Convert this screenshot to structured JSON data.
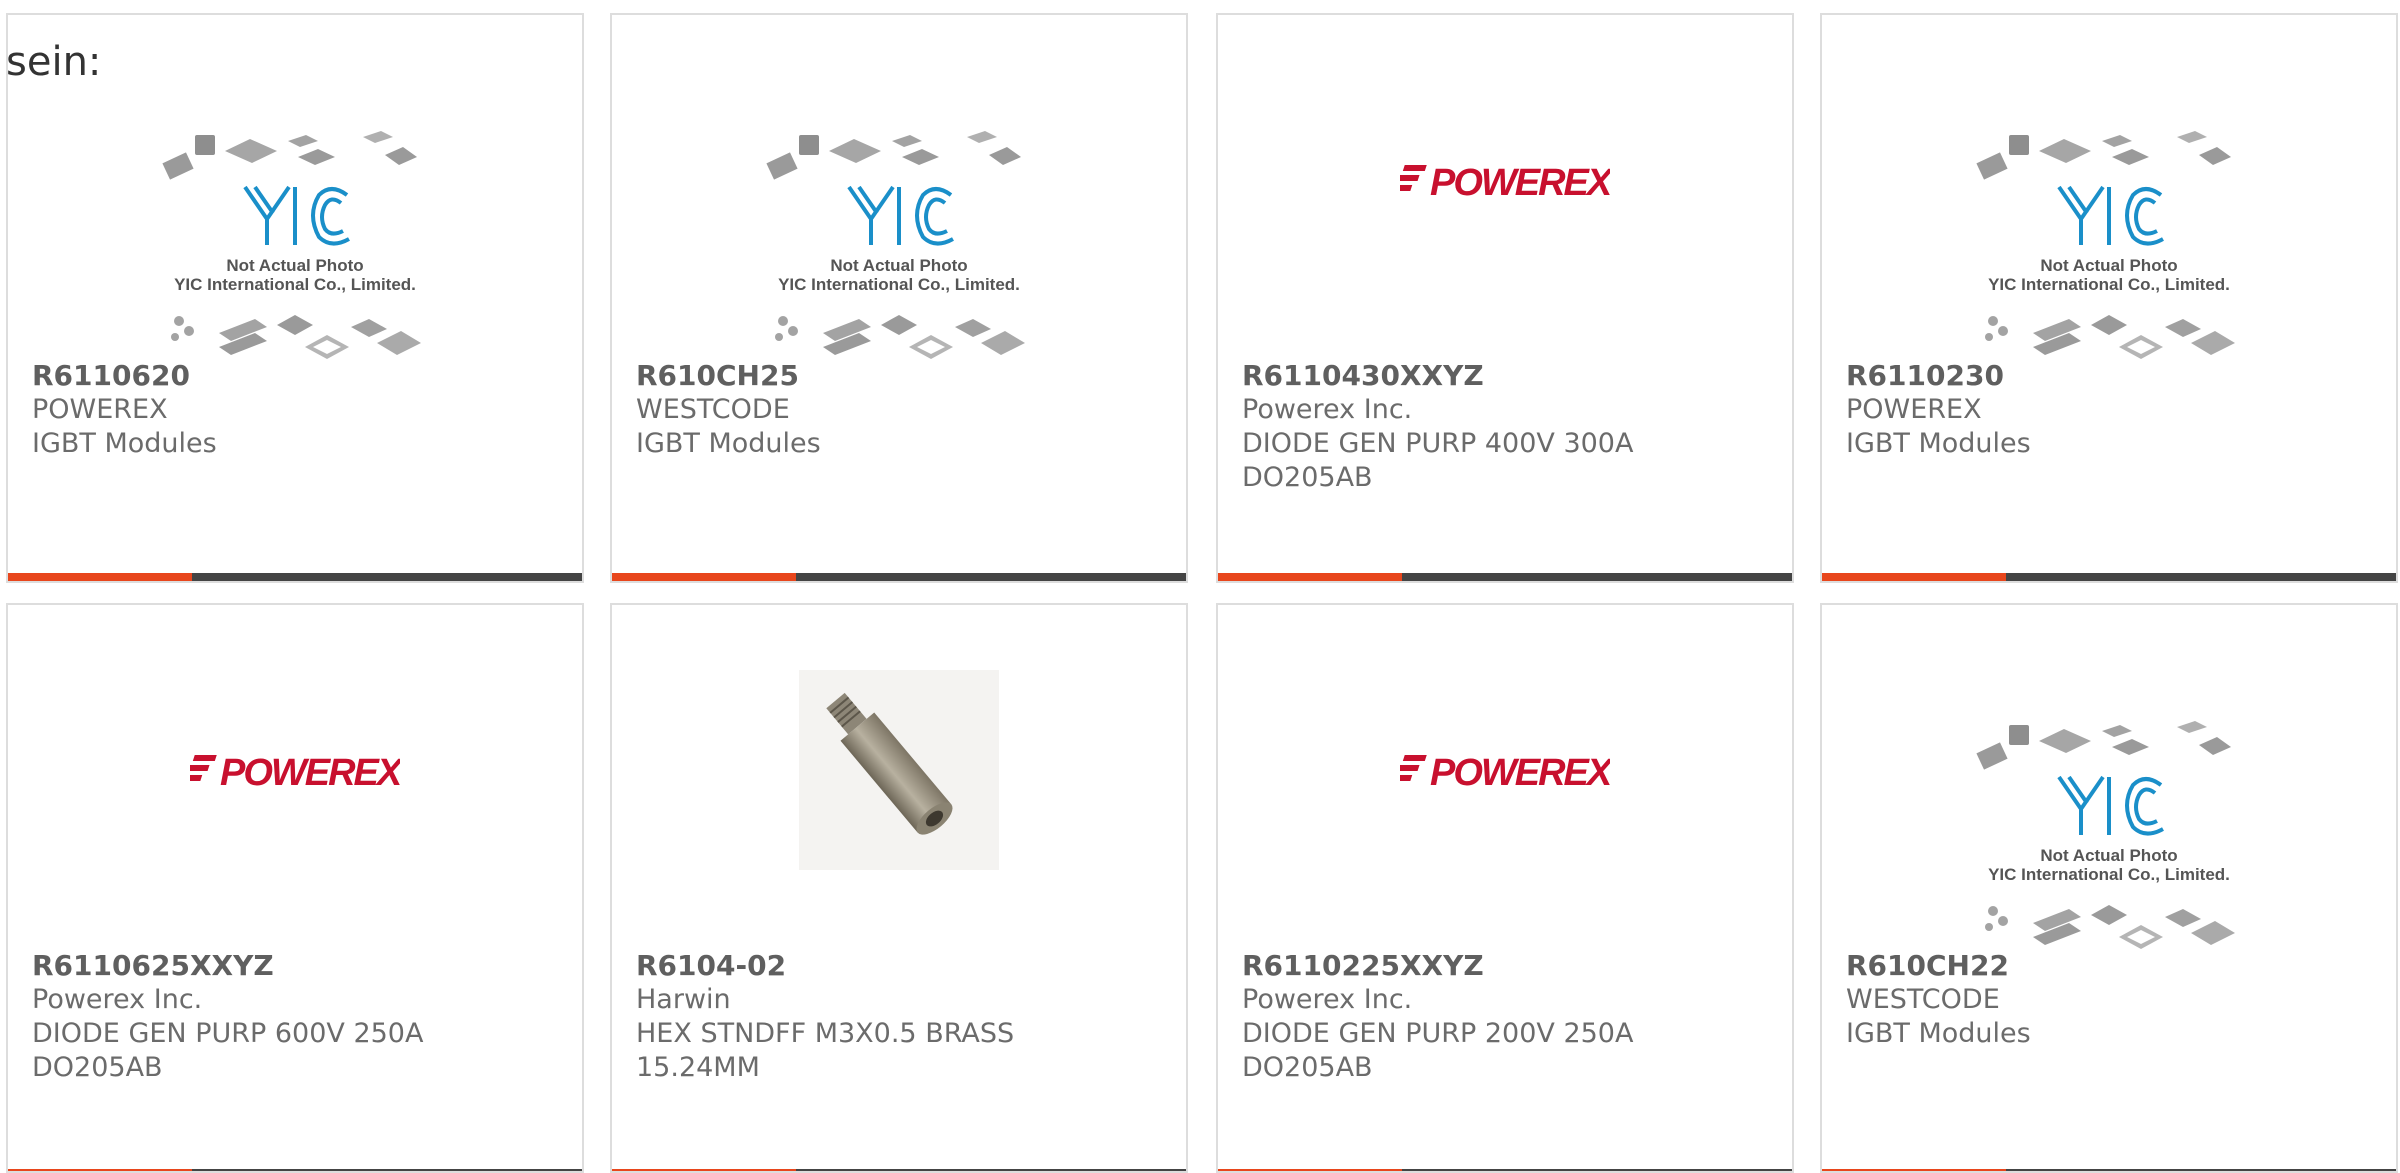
{
  "lead_text": "sein:",
  "placeholder_caption": [
    "Not Actual Photo",
    "YIC International Co., Limited."
  ],
  "placeholder_logo": "YIC",
  "powerex_logo": "POWEREX",
  "accent_colors": {
    "accent": "#e8461c",
    "bar": "#444444",
    "powerex_red": "#c8102e",
    "yic_blue": "#1a8fc9"
  },
  "cards": [
    {
      "image": "yic-placeholder",
      "part": "R6110620",
      "maker": "POWEREX",
      "desc": [
        "IGBT Modules"
      ]
    },
    {
      "image": "yic-placeholder",
      "part": "R610CH25",
      "maker": "WESTCODE",
      "desc": [
        "IGBT Modules"
      ]
    },
    {
      "image": "powerex-logo",
      "part": "R6110430XXYZ",
      "maker": "Powerex Inc.",
      "desc": [
        "DIODE GEN PURP 400V 300A",
        "DO205AB"
      ]
    },
    {
      "image": "yic-placeholder",
      "part": "R6110230",
      "maker": "POWEREX",
      "desc": [
        "IGBT Modules"
      ]
    },
    {
      "image": "powerex-logo",
      "part": "R6110625XXYZ",
      "maker": "Powerex Inc.",
      "desc": [
        "DIODE GEN PURP 600V 250A",
        "DO205AB"
      ]
    },
    {
      "image": "standoff-photo",
      "part": "R6104-02",
      "maker": "Harwin",
      "desc": [
        "HEX STNDFF M3X0.5 BRASS",
        "15.24MM"
      ]
    },
    {
      "image": "powerex-logo",
      "part": "R6110225XXYZ",
      "maker": "Powerex Inc.",
      "desc": [
        "DIODE GEN PURP 200V 250A",
        "DO205AB"
      ]
    },
    {
      "image": "yic-placeholder",
      "part": "R610CH22",
      "maker": "WESTCODE",
      "desc": [
        "IGBT Modules"
      ]
    }
  ]
}
